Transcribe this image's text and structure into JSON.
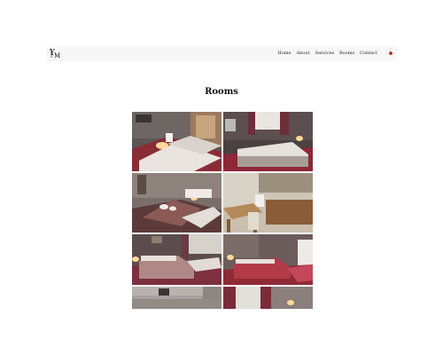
{
  "header": {
    "logo_icon": "ym-monogram-logo",
    "nav": [
      {
        "label": "Home"
      },
      {
        "label": "About"
      },
      {
        "label": "Services"
      },
      {
        "label": "Rooms"
      },
      {
        "label": "Contact"
      }
    ],
    "language_icon": "flag-icon"
  },
  "main": {
    "title": "Rooms"
  },
  "gallery": {
    "photos": [
      {
        "name": "room-photo-twin-beds"
      },
      {
        "name": "room-photo-double-bed-curtains"
      },
      {
        "name": "room-photo-bed-towels"
      },
      {
        "name": "room-photo-kitchenette"
      },
      {
        "name": "room-photo-pink-bedspread"
      },
      {
        "name": "room-photo-red-bedspread"
      },
      {
        "name": "room-photo-partial-left"
      },
      {
        "name": "room-photo-partial-right"
      }
    ]
  },
  "colors": {
    "accent": "#c0392b",
    "header_bg": "#f7f7f7",
    "text": "#111111"
  }
}
